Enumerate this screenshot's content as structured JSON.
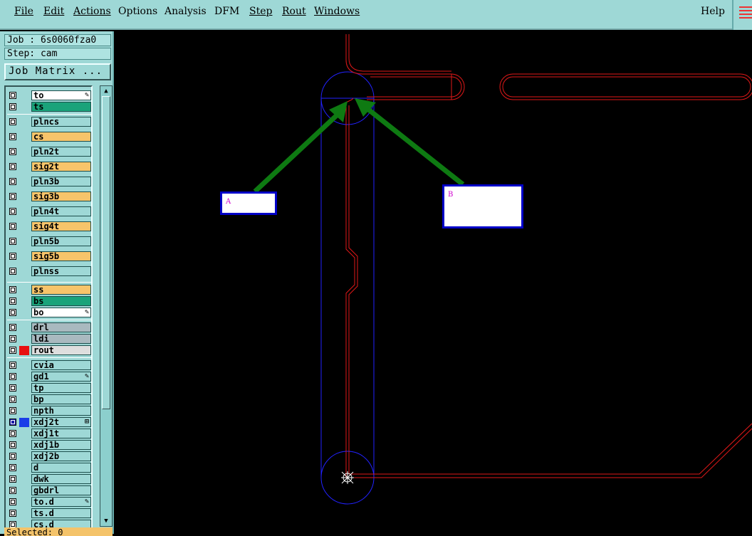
{
  "menubar": {
    "items": [
      "File",
      "Edit",
      "Actions",
      "Options",
      "Analysis",
      "DFM",
      "Step",
      "Rout",
      "Windows"
    ],
    "help": "Help"
  },
  "panel": {
    "job": "Job : 6s0060fza0",
    "step": "Step: cam",
    "job_matrix": "Job Matrix ...",
    "status": "Selected: 0"
  },
  "layers": [
    {
      "name": "to",
      "color": "#ffffff",
      "edit": true
    },
    {
      "name": "ts",
      "color": "#1aa37a"
    },
    {
      "name": "plncs",
      "color": "#9ed8d6"
    },
    {
      "name": "cs",
      "color": "#f7c46a"
    },
    {
      "name": "pln2t",
      "color": "#9ed8d6"
    },
    {
      "name": "sig2t",
      "color": "#f7c46a"
    },
    {
      "name": "pln3b",
      "color": "#9ed8d6"
    },
    {
      "name": "sig3b",
      "color": "#f7c46a"
    },
    {
      "name": "pln4t",
      "color": "#9ed8d6"
    },
    {
      "name": "sig4t",
      "color": "#f7c46a"
    },
    {
      "name": "pln5b",
      "color": "#9ed8d6"
    },
    {
      "name": "sig5b",
      "color": "#f7c46a"
    },
    {
      "name": "plnss",
      "color": "#9ed8d6"
    },
    {
      "name": "ss",
      "color": "#f7c46a"
    },
    {
      "name": "bs",
      "color": "#1aa37a"
    },
    {
      "name": "bo",
      "color": "#ffffff",
      "edit": true
    },
    {
      "name": "drl",
      "color": "#a9b9bf"
    },
    {
      "name": "ldi",
      "color": "#a9b9bf"
    },
    {
      "name": "rout",
      "color": "#dedede",
      "marker": "#e81010"
    },
    {
      "name": "cvia",
      "color": "#9ed8d6"
    },
    {
      "name": "gd1",
      "color": "#9ed8d6",
      "edit": true
    },
    {
      "name": "tp",
      "color": "#9ed8d6"
    },
    {
      "name": "bp",
      "color": "#9ed8d6"
    },
    {
      "name": "npth",
      "color": "#9ed8d6"
    },
    {
      "name": "xdj2t",
      "color": "#9ed8d6",
      "selected": true,
      "marker": "#1a3ee8",
      "edit_box": true
    },
    {
      "name": "xdj1t",
      "color": "#9ed8d6"
    },
    {
      "name": "xdj1b",
      "color": "#9ed8d6"
    },
    {
      "name": "xdj2b",
      "color": "#9ed8d6"
    },
    {
      "name": "d",
      "color": "#9ed8d6"
    },
    {
      "name": "dwk",
      "color": "#9ed8d6"
    },
    {
      "name": "gbdrl",
      "color": "#9ed8d6"
    },
    {
      "name": "to.d",
      "color": "#9ed8d6",
      "edit": true
    },
    {
      "name": "ts.d",
      "color": "#9ed8d6"
    },
    {
      "name": "cs.d",
      "color": "#9ed8d6"
    }
  ],
  "annotations": {
    "a": "A",
    "b": "B"
  }
}
